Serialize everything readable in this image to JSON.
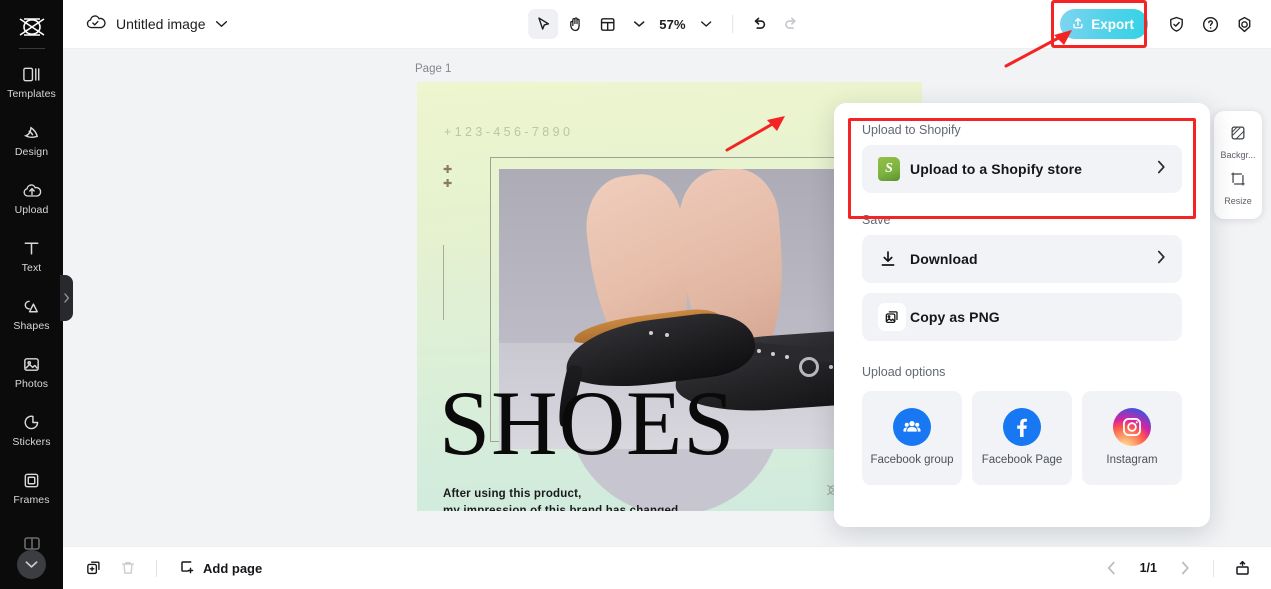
{
  "app": {
    "name": "CapCut",
    "watermark": "CapCut"
  },
  "sidebar": {
    "items": [
      {
        "label": "Templates",
        "icon": "templates-icon"
      },
      {
        "label": "Design",
        "icon": "design-icon"
      },
      {
        "label": "Upload",
        "icon": "upload-cloud-icon"
      },
      {
        "label": "Text",
        "icon": "text-icon"
      },
      {
        "label": "Shapes",
        "icon": "shapes-icon"
      },
      {
        "label": "Photos",
        "icon": "photos-icon"
      },
      {
        "label": "Stickers",
        "icon": "stickers-icon"
      },
      {
        "label": "Frames",
        "icon": "frames-icon"
      }
    ],
    "more_icon": "chevron-down-icon",
    "collapse_icon": "chevron-right-icon"
  },
  "topbar": {
    "cloud_icon": "cloud-check-icon",
    "doc_title": "Untitled image",
    "title_caret": "chevron-down-icon",
    "tools": [
      {
        "name": "select-tool",
        "icon": "cursor-arrow-icon",
        "active": true
      },
      {
        "name": "hand-tool",
        "icon": "hand-icon",
        "active": false
      },
      {
        "name": "layout-tool",
        "icon": "layout-grid-icon",
        "active": false
      }
    ],
    "zoom_level": "57%",
    "undo_icon": "undo-icon",
    "redo_icon": "redo-icon",
    "export_label": "Export",
    "export_icon": "upload-icon",
    "export_color": "#44d2e8",
    "right_icons": [
      {
        "name": "shield-check-icon"
      },
      {
        "name": "help-circle-icon"
      },
      {
        "name": "settings-gear-icon"
      }
    ]
  },
  "canvas": {
    "page_label": "Page 1",
    "artwork": {
      "phone": "+123-456-7890",
      "headline": "SHOES",
      "tagline_line1": "After using this product,",
      "tagline_line2": "my impression of this brand has changed.",
      "bg_top_color": "#eef5cf",
      "bg_bottom_color": "#cfeade"
    }
  },
  "right_panel": {
    "items": [
      {
        "label": "Backgr...",
        "icon": "background-icon"
      },
      {
        "label": "Resize",
        "icon": "resize-icon"
      }
    ]
  },
  "export_menu": {
    "section_shopify": "Upload to Shopify",
    "shopify_row": {
      "label": "Upload to a Shopify store",
      "icon": "shopify-icon",
      "chevron": "chevron-right-icon"
    },
    "section_save": "Save",
    "save_rows": [
      {
        "label": "Download",
        "icon": "download-icon",
        "chevron": "chevron-right-icon"
      },
      {
        "label": "Copy as PNG",
        "icon": "copy-image-icon",
        "chevron": ""
      }
    ],
    "section_upload_options": "Upload options",
    "upload_options": [
      {
        "label": "Facebook group",
        "icon": "facebook-group-icon",
        "color": "#1877f2"
      },
      {
        "label": "Facebook Page",
        "icon": "facebook-icon",
        "color": "#1877f2"
      },
      {
        "label": "Instagram",
        "icon": "instagram-icon",
        "color": "#d6249f"
      }
    ]
  },
  "bottombar": {
    "duplicate_icon": "duplicate-page-icon",
    "delete_icon": "trash-icon",
    "add_page_label": "Add page",
    "add_page_icon": "plus-square-icon",
    "prev_icon": "chevron-left-icon",
    "next_icon": "chevron-right-icon",
    "page_indicator": "1/1",
    "present_icon": "present-icon"
  },
  "annotations": {
    "highlight_color": "#f42424",
    "boxes": [
      "export-button",
      "upload-to-shopify-section"
    ],
    "arrows": [
      "arrow-to-export",
      "arrow-to-shopify"
    ]
  }
}
